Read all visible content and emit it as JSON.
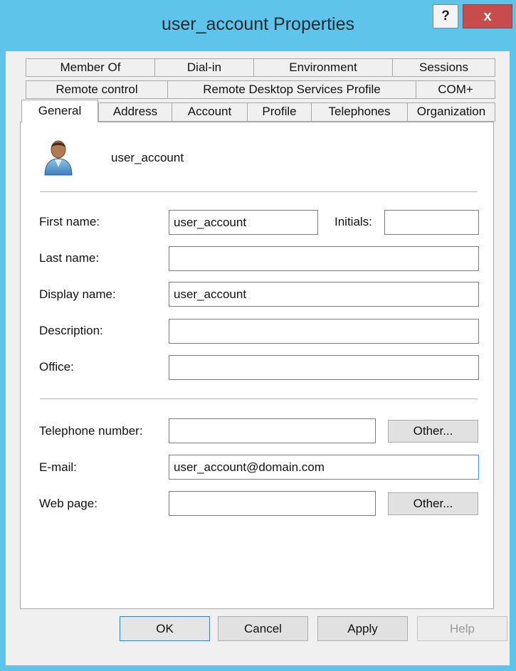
{
  "window": {
    "title": "user_account Properties",
    "help_glyph": "?",
    "close_glyph": "x"
  },
  "tabs": {
    "row1": [
      "Member Of",
      "Dial-in",
      "Environment",
      "Sessions"
    ],
    "row2": [
      "Remote control",
      "Remote Desktop Services Profile",
      "COM+"
    ],
    "row3": [
      "General",
      "Address",
      "Account",
      "Profile",
      "Telephones",
      "Organization"
    ],
    "active": "General"
  },
  "general": {
    "account_name": "user_account",
    "avatar_icon": "user-avatar-icon",
    "first_name_label": "First name:",
    "first_name_value": "user_account",
    "initials_label": "Initials:",
    "initials_value": "",
    "last_name_label": "Last name:",
    "last_name_value": "",
    "display_name_label": "Display name:",
    "display_name_value": "user_account",
    "description_label": "Description:",
    "description_value": "",
    "office_label": "Office:",
    "office_value": "",
    "telephone_label": "Telephone number:",
    "telephone_value": "",
    "telephone_other": "Other...",
    "email_label": "E-mail:",
    "email_value": "user_account@domain.com",
    "webpage_label": "Web page:",
    "webpage_value": "",
    "webpage_other": "Other..."
  },
  "footer": {
    "ok": "OK",
    "cancel": "Cancel",
    "apply": "Apply",
    "help": "Help"
  },
  "colors": {
    "title_bar": "#5fc4ea",
    "close_button": "#c94c4c",
    "focus_border": "#3d8fd1"
  }
}
